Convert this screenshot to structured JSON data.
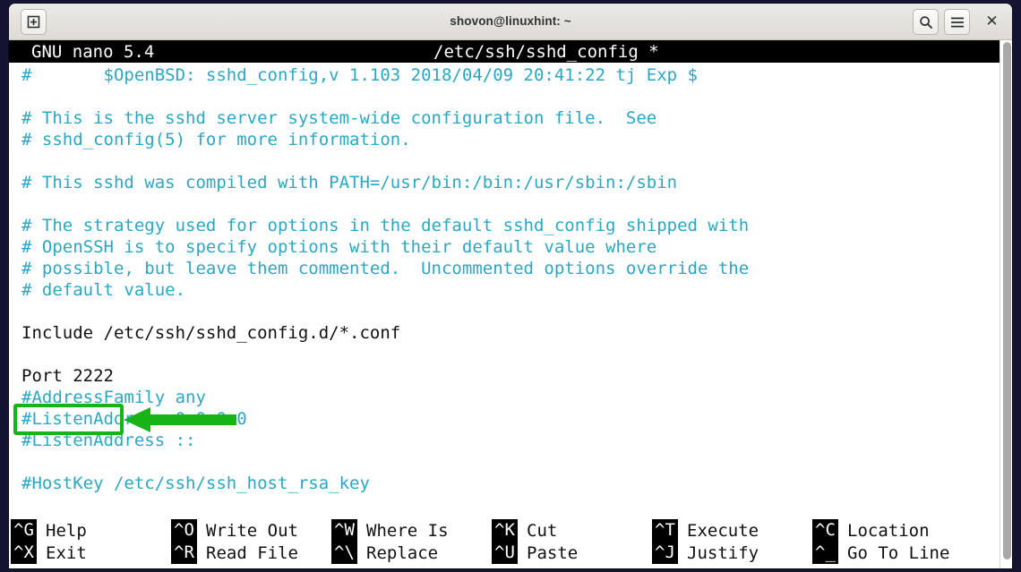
{
  "window": {
    "title": "shovon@linuxhint: ~",
    "buttons": {
      "new_tab": "new-tab",
      "search": "⌕",
      "menu": "☰",
      "close": "✕"
    }
  },
  "nano": {
    "header": {
      "version": "GNU nano 5.4",
      "filename": "/etc/ssh/sshd_config *"
    },
    "document": [
      {
        "text": "#       $OpenBSD: sshd_config,v 1.103 2018/04/09 20:41:22 tj Exp $",
        "style": "comment"
      },
      {
        "text": "",
        "style": "blank"
      },
      {
        "text": "# This is the sshd server system-wide configuration file.  See",
        "style": "comment"
      },
      {
        "text": "# sshd_config(5) for more information.",
        "style": "comment"
      },
      {
        "text": "",
        "style": "blank"
      },
      {
        "text": "# This sshd was compiled with PATH=/usr/bin:/bin:/usr/sbin:/sbin",
        "style": "comment"
      },
      {
        "text": "",
        "style": "blank"
      },
      {
        "text": "# The strategy used for options in the default sshd_config shipped with",
        "style": "comment"
      },
      {
        "text": "# OpenSSH is to specify options with their default value where",
        "style": "comment"
      },
      {
        "text": "# possible, but leave them commented.  Uncommented options override the",
        "style": "comment"
      },
      {
        "text": "# default value.",
        "style": "comment"
      },
      {
        "text": "",
        "style": "blank"
      },
      {
        "text": "Include /etc/ssh/sshd_config.d/*.conf",
        "style": "plain"
      },
      {
        "text": "",
        "style": "blank"
      },
      {
        "text": "Port 2222",
        "style": "plain"
      },
      {
        "text": "#AddressFamily any",
        "style": "comment"
      },
      {
        "text": "#ListenAddress 0.0.0.0",
        "style": "comment"
      },
      {
        "text": "#ListenAddress ::",
        "style": "comment"
      },
      {
        "text": "",
        "style": "blank"
      },
      {
        "text": "#HostKey /etc/ssh/ssh_host_rsa_key",
        "style": "comment"
      }
    ],
    "shortcuts": [
      {
        "top_key": "^G",
        "top_label": "Help",
        "bottom_key": "^X",
        "bottom_label": "Exit"
      },
      {
        "top_key": "^O",
        "top_label": "Write Out",
        "bottom_key": "^R",
        "bottom_label": "Read File"
      },
      {
        "top_key": "^W",
        "top_label": "Where Is",
        "bottom_key": "^\\",
        "bottom_label": "Replace"
      },
      {
        "top_key": "^K",
        "top_label": "Cut",
        "bottom_key": "^U",
        "bottom_label": "Paste"
      },
      {
        "top_key": "^T",
        "top_label": "Execute",
        "bottom_key": "^J",
        "bottom_label": "Justify"
      },
      {
        "top_key": "^C",
        "top_label": "Location",
        "bottom_key": "^_",
        "bottom_label": "Go To Line"
      }
    ]
  },
  "annotation": {
    "target_text": "Port 2222",
    "highlight_color": "#17b317",
    "arrow_color": "#17b317"
  },
  "colors": {
    "comment_text": "#2aa7c4",
    "plain_text": "#111111",
    "terminal_background": "#ffffff",
    "header_background": "#000000",
    "desktop_background": "#141432"
  }
}
